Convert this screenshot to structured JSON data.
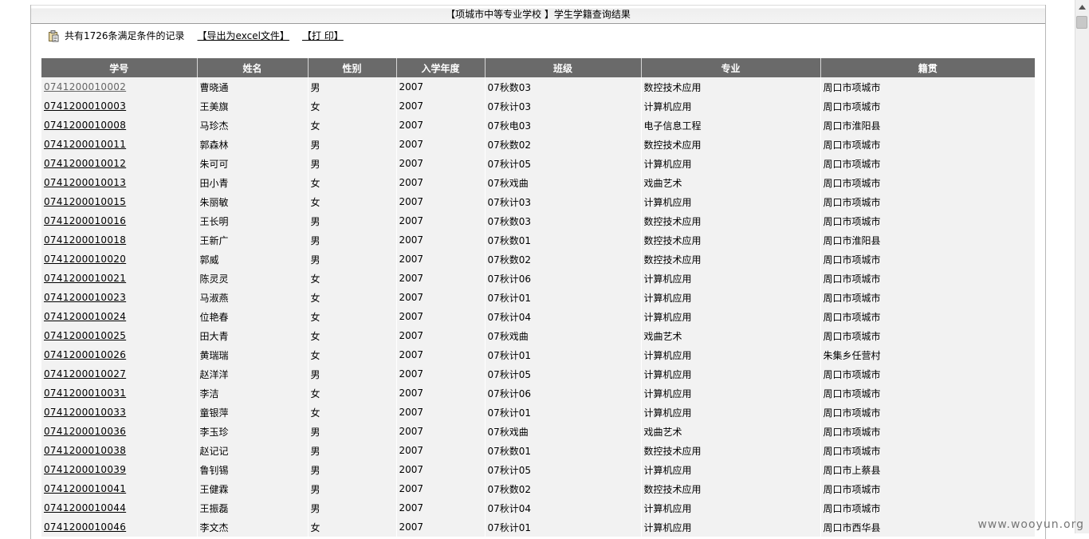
{
  "title": "【项城市中等专业学校 】学生学籍查询结果",
  "toolbar": {
    "count_text": "共有1726条满足条件的记录",
    "export_label": "【导出为excel文件】",
    "print_label": "【打 印】"
  },
  "table": {
    "headers": [
      "学号",
      "姓名",
      "性别",
      "入学年度",
      "班级",
      "专业",
      "籍贯"
    ],
    "rows": [
      [
        "0741200010002",
        "曹晓通",
        "男",
        "2007",
        "07秋数03",
        "数控技术应用",
        "周口市项城市"
      ],
      [
        "0741200010003",
        "王美旗",
        "女",
        "2007",
        "07秋计03",
        "计算机应用",
        "周口市项城市"
      ],
      [
        "0741200010008",
        "马珍杰",
        "女",
        "2007",
        "07秋电03",
        "电子信息工程",
        "周口市淮阳县"
      ],
      [
        "0741200010011",
        "郭森林",
        "男",
        "2007",
        "07秋数02",
        "数控技术应用",
        "周口市项城市"
      ],
      [
        "0741200010012",
        "朱可可",
        "男",
        "2007",
        "07秋计05",
        "计算机应用",
        "周口市项城市"
      ],
      [
        "0741200010013",
        "田小青",
        "女",
        "2007",
        "07秋戏曲",
        "戏曲艺术",
        "周口市项城市"
      ],
      [
        "0741200010015",
        "朱丽敏",
        "女",
        "2007",
        "07秋计03",
        "计算机应用",
        "周口市项城市"
      ],
      [
        "0741200010016",
        "王长明",
        "男",
        "2007",
        "07秋数03",
        "数控技术应用",
        "周口市项城市"
      ],
      [
        "0741200010018",
        "王新广",
        "男",
        "2007",
        "07秋数01",
        "数控技术应用",
        "周口市淮阳县"
      ],
      [
        "0741200010020",
        "郭威",
        "男",
        "2007",
        "07秋数02",
        "数控技术应用",
        "周口市项城市"
      ],
      [
        "0741200010021",
        "陈灵灵",
        "女",
        "2007",
        "07秋计06",
        "计算机应用",
        "周口市项城市"
      ],
      [
        "0741200010023",
        "马淑燕",
        "女",
        "2007",
        "07秋计01",
        "计算机应用",
        "周口市项城市"
      ],
      [
        "0741200010024",
        "位艳春",
        "女",
        "2007",
        "07秋计04",
        "计算机应用",
        "周口市项城市"
      ],
      [
        "0741200010025",
        "田大青",
        "女",
        "2007",
        "07秋戏曲",
        "戏曲艺术",
        "周口市项城市"
      ],
      [
        "0741200010026",
        "黄瑞瑞",
        "女",
        "2007",
        "07秋计01",
        "计算机应用",
        "朱集乡任营村"
      ],
      [
        "0741200010027",
        "赵洋洋",
        "男",
        "2007",
        "07秋计05",
        "计算机应用",
        "周口市项城市"
      ],
      [
        "0741200010031",
        "李洁",
        "女",
        "2007",
        "07秋计06",
        "计算机应用",
        "周口市项城市"
      ],
      [
        "0741200010033",
        "童银萍",
        "女",
        "2007",
        "07秋计01",
        "计算机应用",
        "周口市项城市"
      ],
      [
        "0741200010036",
        "李玉珍",
        "男",
        "2007",
        "07秋戏曲",
        "戏曲艺术",
        "周口市项城市"
      ],
      [
        "0741200010038",
        "赵记记",
        "男",
        "2007",
        "07秋数01",
        "数控技术应用",
        "周口市项城市"
      ],
      [
        "0741200010039",
        "鲁钊锡",
        "男",
        "2007",
        "07秋计05",
        "计算机应用",
        "周口市上蔡县"
      ],
      [
        "0741200010041",
        "王健霖",
        "男",
        "2007",
        "07秋数02",
        "数控技术应用",
        "周口市项城市"
      ],
      [
        "0741200010044",
        "王振磊",
        "男",
        "2007",
        "07秋计04",
        "计算机应用",
        "周口市项城市"
      ],
      [
        "0741200010046",
        "李文杰",
        "女",
        "2007",
        "07秋计01",
        "计算机应用",
        "周口市西华县"
      ]
    ]
  },
  "watermark": "www.wooyun.org"
}
